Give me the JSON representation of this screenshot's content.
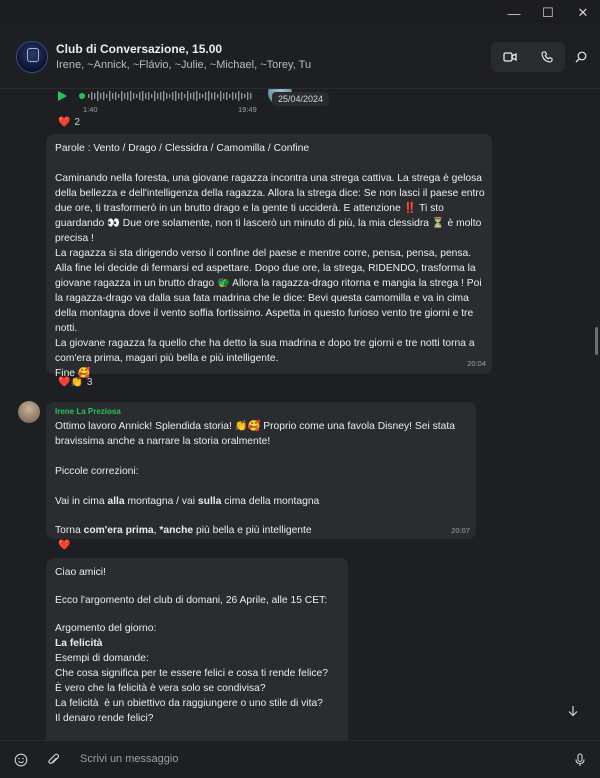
{
  "window": {
    "minimize": "—",
    "maximize": "☐",
    "close": "✕"
  },
  "header": {
    "title": "Club di Conversazione, 15.00",
    "subtitle": "Irene, ~Annick, ~Flávio, ~Julie, ~Michael, ~Torey, Tu"
  },
  "icons": {
    "video": "video-icon",
    "phone": "phone-icon",
    "search": "search-icon",
    "emoji": "emoji-icon",
    "attach": "paperclip-icon",
    "mic": "microphone-icon",
    "scroll_down": "chevron-down-icon"
  },
  "audio": {
    "elapsed": "1:40",
    "time": "19:49",
    "date_chip": "25/04/2024"
  },
  "reaction1": {
    "emoji": "❤️",
    "count": "2"
  },
  "story": {
    "words": "Parole : Vento / Drago / Clessidra / Camomilla / Confine",
    "p1": "Caminando nella foresta, una giovane ragazza incontra una strega cattiva. La strega è gelosa della bellezza e dell'intelligenza della ragazza. Allora la strega dice: Se non lasci il paese entro due ore, ti trasformerò in un brutto drago e la gente ti ucciderà. E attenzione ‼️ Ti sto guardando 👀 Due ore solamente, non ti lascerò un minuto di più, la mia clessidra ⏳ è molto precisa !",
    "p2": "La ragazza si sta dirigendo verso il confine del paese e mentre corre, pensa, pensa, pensa. Alla fine lei decide di fermarsi ed aspettare. Dopo due ore, la strega, RIDENDO, trasforma la giovane ragazza in un brutto drago 🐲 Allora la ragazza-drago ritorna e mangia la strega ! Poi la ragazza-drago va dalla sua fata madrina che le dice: Bevi questa camomilla e va in cima della montagna dove il vento soffia fortissimo. Aspetta in questo furioso vento tre giorni e tre notti.",
    "p3": "La giovane ragazza fa quello che ha detto la sua madrina e dopo tre giorni e tre notti torna a com'era prima, magari più bella e più intelligente.",
    "end": "Fine 🥰",
    "time": "20:04"
  },
  "reaction2": {
    "emojis": "❤️👏",
    "count": "3"
  },
  "irene": {
    "sender": "Irene La Preziosa",
    "line1": "Ottimo lavoro Annick! Splendida storia! 👏🥰 Proprio come una favola Disney! Sei stata bravissima anche a narrare la storia oralmente!",
    "line2": "Piccole correzioni:",
    "c1a": "Vai in cima ",
    "c1b": "alla",
    "c1c": " montagna / vai ",
    "c1d": "sulla",
    "c1e": " cima della montagna",
    "c2a": "Torna ",
    "c2b": "com'era prima",
    "c2c": ", ",
    "c2d": "*anche",
    "c2e": " più bella e più intelligente",
    "time": "20:07"
  },
  "reaction3": {
    "emoji": "❤️"
  },
  "announce": {
    "greet": "Ciao amici!",
    "topic": "Ecco l'argomento del club di domani, 26 Aprile, alle 15 CET:",
    "arg_label": "Argomento del giorno:",
    "arg_title": "La felicità",
    "examples": "Esempi di domande:",
    "q1": "Che cosa significa per te essere felici e cosa ti rende felice?",
    "q2": "È vero che la felicità è vera solo se condivisa?",
    "q3": "La felicità  è un obiettivo da raggiungere o uno stile di vita?",
    "q4": "Il denaro rende felici?"
  },
  "composer": {
    "placeholder": "Scrivi un messaggio"
  }
}
